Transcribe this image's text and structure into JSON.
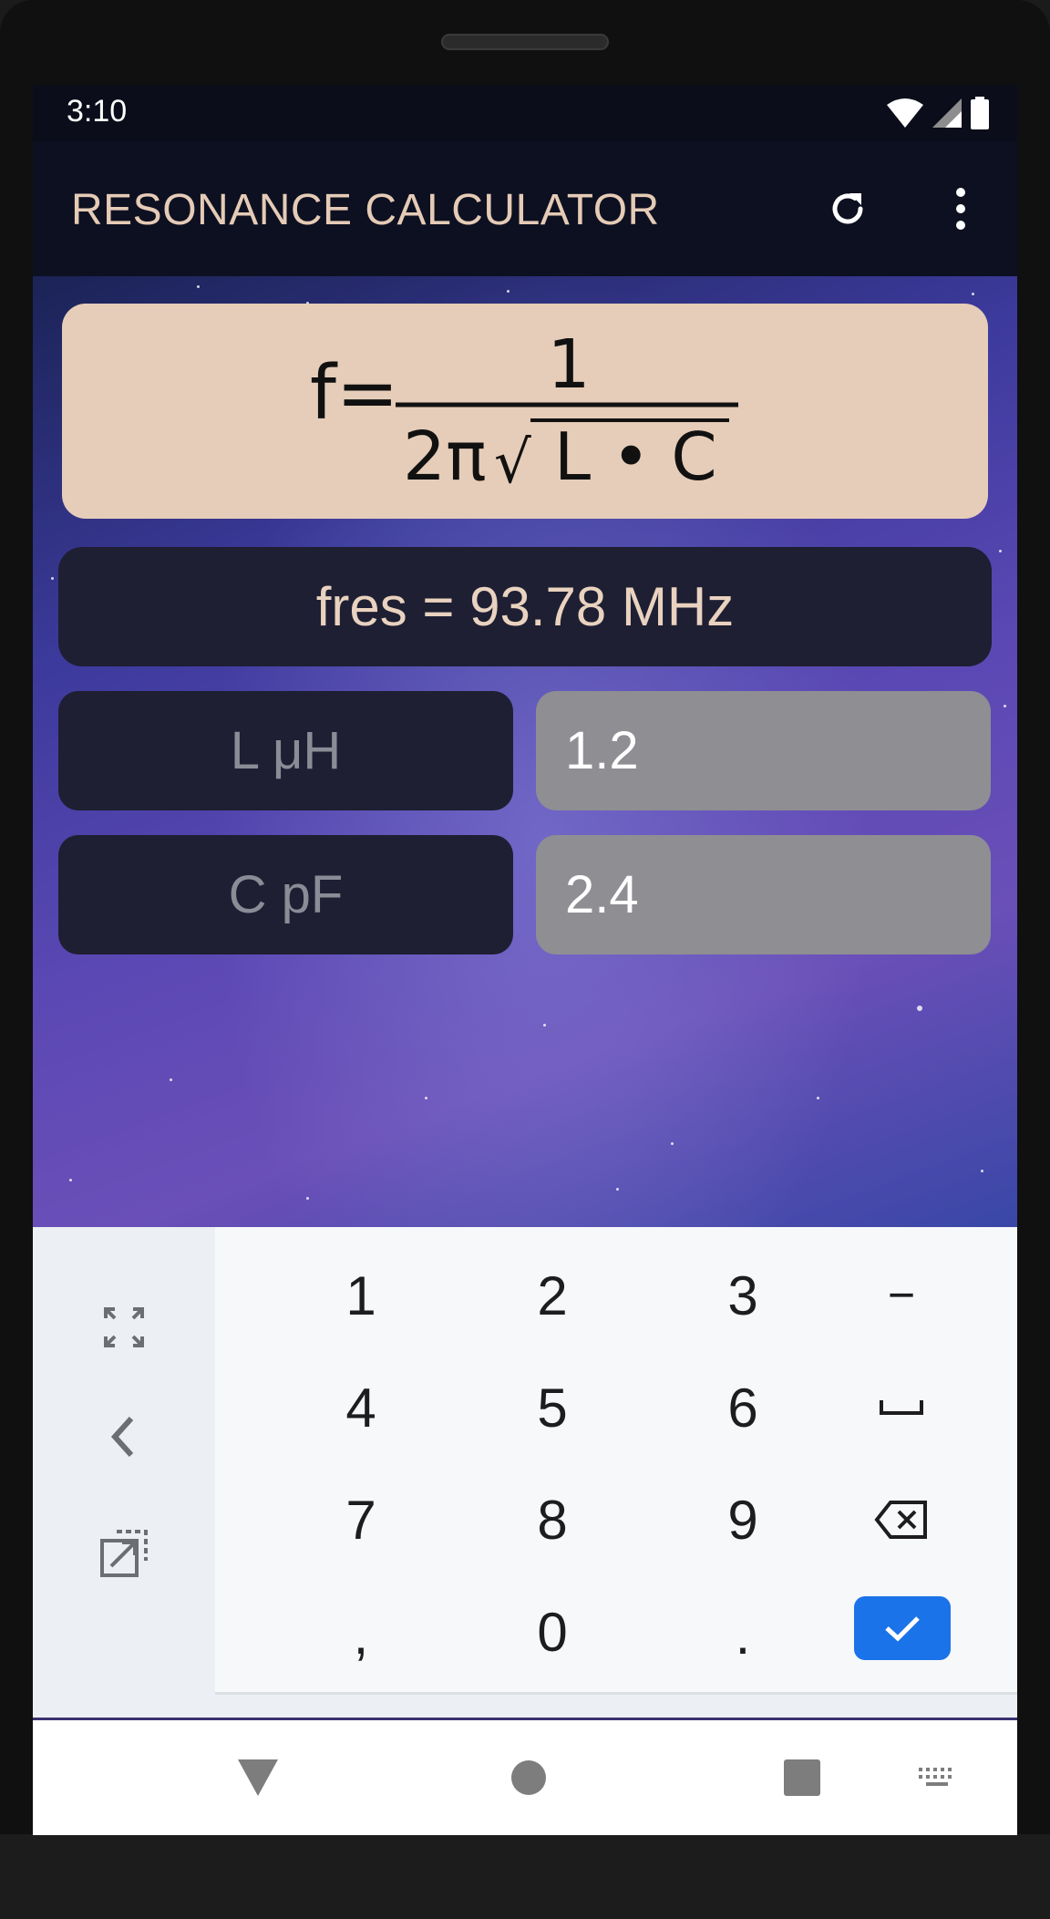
{
  "status_bar": {
    "time": "3:10"
  },
  "app_bar": {
    "title": "RESONANCE CALCULATOR"
  },
  "formula": {
    "lhs": "f=",
    "numerator": "1",
    "denominator_prefix": "2π",
    "radical": "√",
    "radicand": "L • C"
  },
  "result": {
    "text": "fres = 93.78 MHz"
  },
  "inputs": [
    {
      "label": "L μH",
      "value": "1.2"
    },
    {
      "label": "C pF",
      "value": "2.4"
    }
  ],
  "keyboard": {
    "keys": [
      "1",
      "2",
      "3",
      "−",
      "4",
      "5",
      "6",
      "␣",
      "7",
      "8",
      "9",
      "⌫",
      ",",
      "0",
      "."
    ],
    "side_icons": [
      "expand-icon",
      "back-chevron-icon",
      "popout-icon"
    ],
    "enter_icon": "check-icon"
  },
  "colors": {
    "accent": "#e5cbb6",
    "formula_bg": "#e6cdb9",
    "panel_bg": "#1e1f33",
    "input_bg": "#8e8e93",
    "enter_blue": "#1a73e8"
  }
}
